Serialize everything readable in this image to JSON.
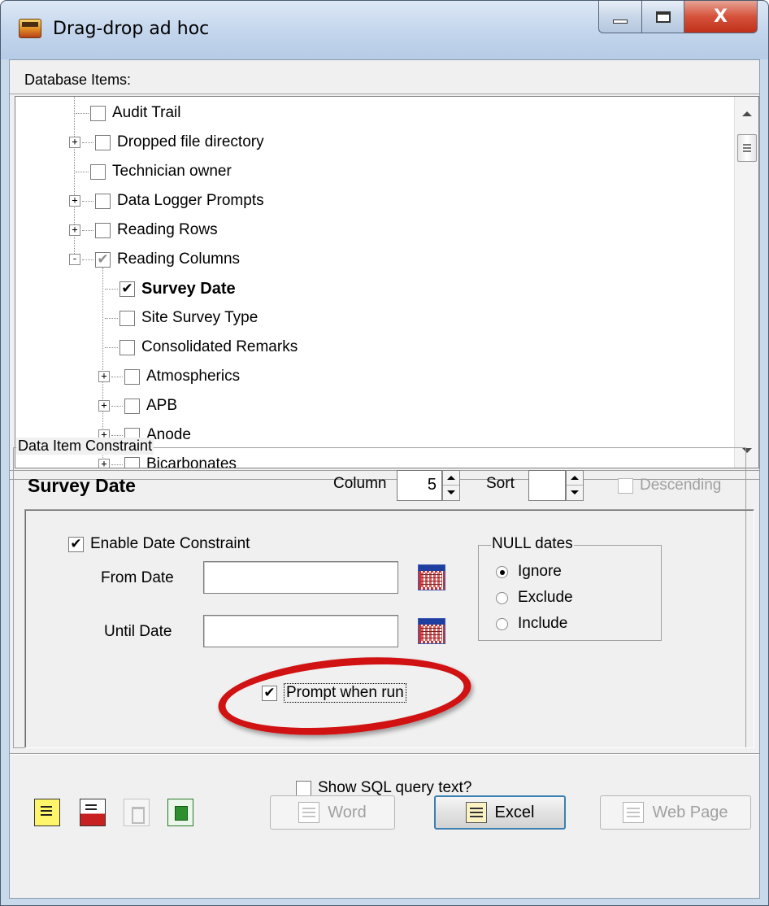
{
  "window": {
    "title": "Drag-drop ad hoc",
    "close_glyph": "X"
  },
  "tree": {
    "header": "Database Items:",
    "items": [
      {
        "label": "Audit Trail",
        "checked": false,
        "expander": ""
      },
      {
        "label": "Dropped file directory",
        "checked": false,
        "expander": "+"
      },
      {
        "label": "Technician owner",
        "checked": false,
        "expander": ""
      },
      {
        "label": "Data Logger Prompts",
        "checked": false,
        "expander": "+"
      },
      {
        "label": "Reading Rows",
        "checked": false,
        "expander": "+"
      },
      {
        "label": "Reading Columns",
        "checked": "partial",
        "expander": "-"
      },
      {
        "label": "Survey Date",
        "checked": true,
        "expander": ""
      },
      {
        "label": "Site Survey Type",
        "checked": false,
        "expander": ""
      },
      {
        "label": "Consolidated Remarks",
        "checked": false,
        "expander": ""
      },
      {
        "label": "Atmospherics",
        "checked": false,
        "expander": "+"
      },
      {
        "label": "APB",
        "checked": false,
        "expander": "+"
      },
      {
        "label": "Anode",
        "checked": false,
        "expander": "+"
      },
      {
        "label": "Bicarbonates",
        "checked": false,
        "expander": "+"
      }
    ]
  },
  "constraint": {
    "group_label": "Data Item Constraint",
    "field_name": "Survey Date",
    "column_label": "Column",
    "column_value": "5",
    "sort_label": "Sort",
    "sort_value": "",
    "descending_label": "Descending",
    "enable_date_label": "Enable Date Constraint",
    "from_label": "From Date",
    "from_value": "",
    "until_label": "Until Date",
    "until_value": "",
    "null_group_label": "NULL dates",
    "null_options": [
      "Ignore",
      "Exclude",
      "Include"
    ],
    "null_selected": "Ignore",
    "prompt_label": "Prompt when run"
  },
  "footer": {
    "show_sql_label": "Show SQL query text?",
    "word_label": "Word",
    "excel_label": "Excel",
    "web_label": "Web Page"
  },
  "icons": {
    "check_glyph": "✔",
    "close_glyph": "X"
  },
  "colors": {
    "highlight_oval": "#d11212",
    "titlebar": "#c2d5ec",
    "close_button": "#c0301b"
  }
}
